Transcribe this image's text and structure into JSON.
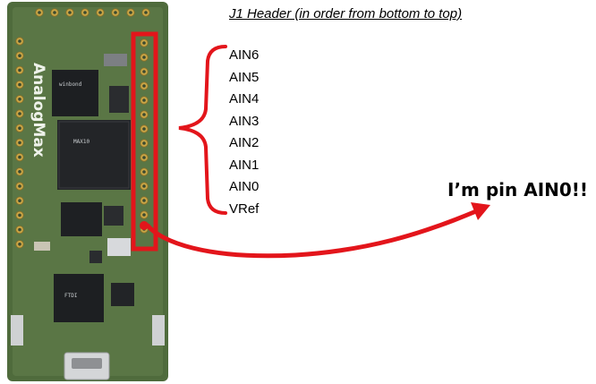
{
  "header": {
    "title": "J1 Header (in order from bottom to top)"
  },
  "pins": [
    "AIN6",
    "AIN5",
    "AIN4",
    "AIN3",
    "AIN2",
    "AIN1",
    "AIN0",
    "VRef"
  ],
  "callout": {
    "text": "I’m pin AIN0!!"
  },
  "board": {
    "name": "AnalogMax",
    "chip_top_text": "winbond",
    "chip_main_text": "MAX10",
    "chip_bottom_text": "FTDI"
  },
  "colors": {
    "highlight_red": "#e3151b",
    "board_green": "#4f6b3c",
    "pad_gold": "#c9a646"
  }
}
